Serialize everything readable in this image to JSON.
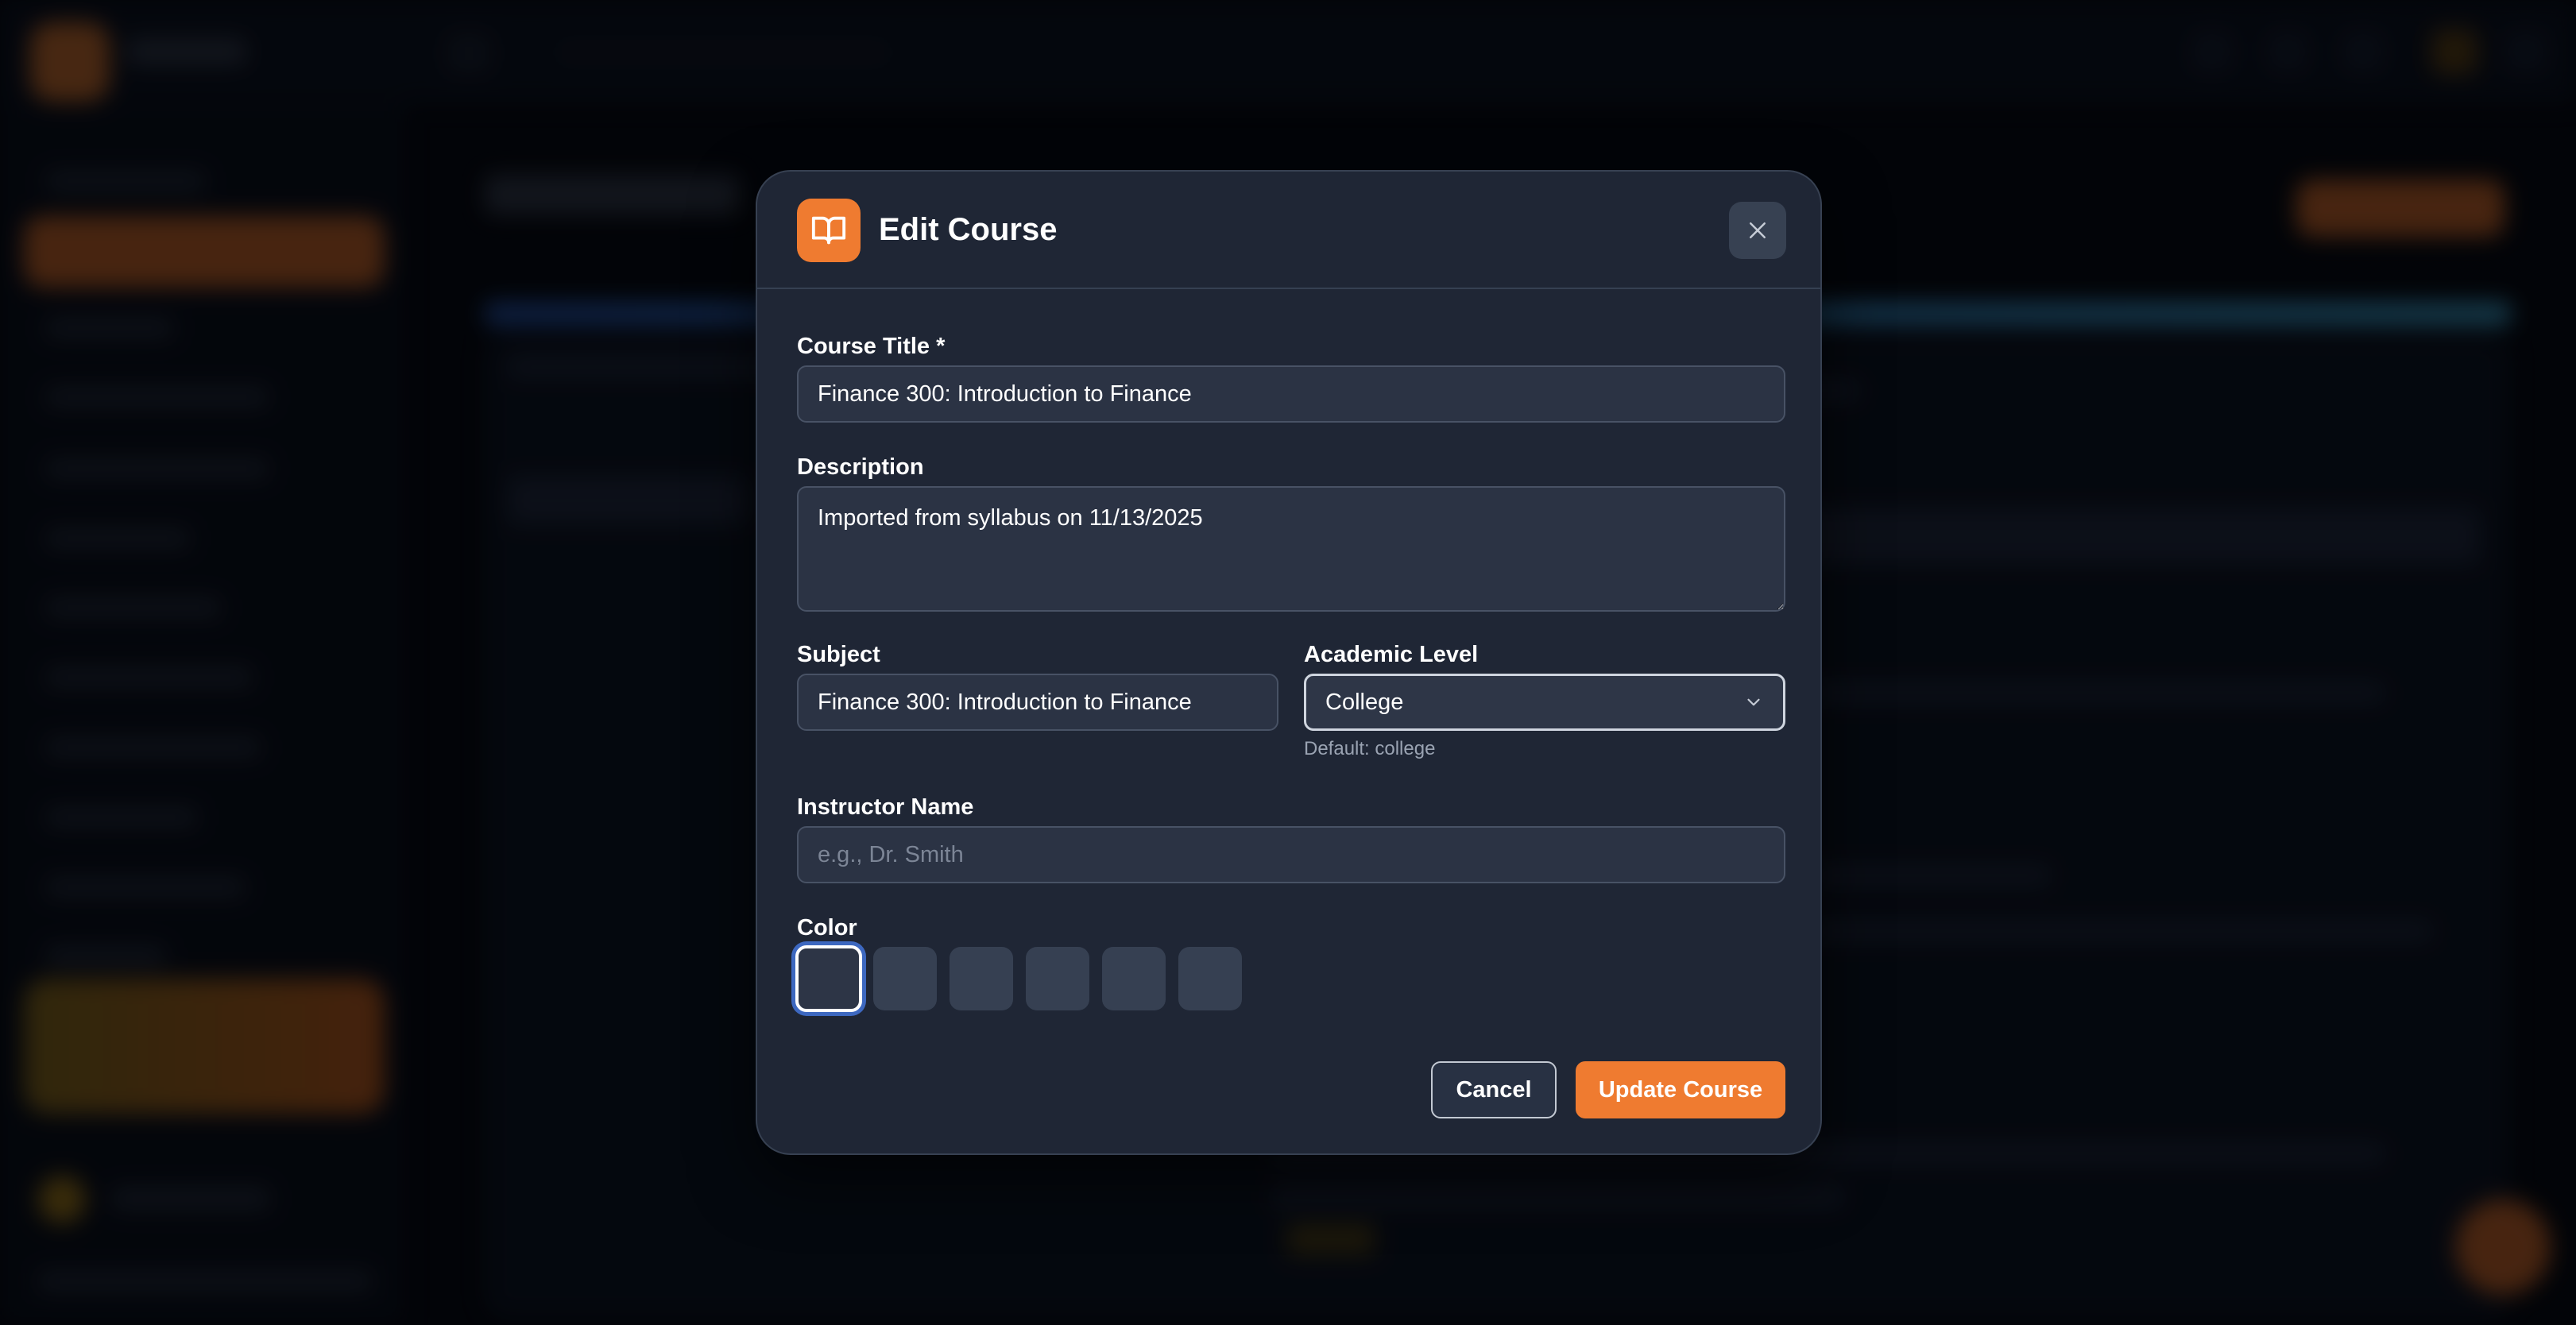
{
  "modal": {
    "title": "Edit Course",
    "fields": {
      "course_title": {
        "label": "Course Title *",
        "value": "Finance 300: Introduction to Finance"
      },
      "description": {
        "label": "Description",
        "value": "Imported from syllabus on 11/13/2025"
      },
      "subject": {
        "label": "Subject",
        "value": "Finance 300: Introduction to Finance"
      },
      "academic_level": {
        "label": "Academic Level",
        "selected": "College",
        "helper": "Default: college"
      },
      "instructor_name": {
        "label": "Instructor Name",
        "value": "",
        "placeholder": "e.g., Dr. Smith"
      },
      "color": {
        "label": "Color",
        "selected_index": 0
      }
    },
    "buttons": {
      "cancel": "Cancel",
      "update": "Update Course"
    }
  },
  "icons": {
    "header": "book-open-icon",
    "close": "close-icon",
    "select": "chevron-down-icon"
  },
  "colors": {
    "accent": "#ef7b30",
    "modal_background": "#1f2635",
    "field_background": "#2b3344",
    "selection_ring": "#3d68c0"
  }
}
